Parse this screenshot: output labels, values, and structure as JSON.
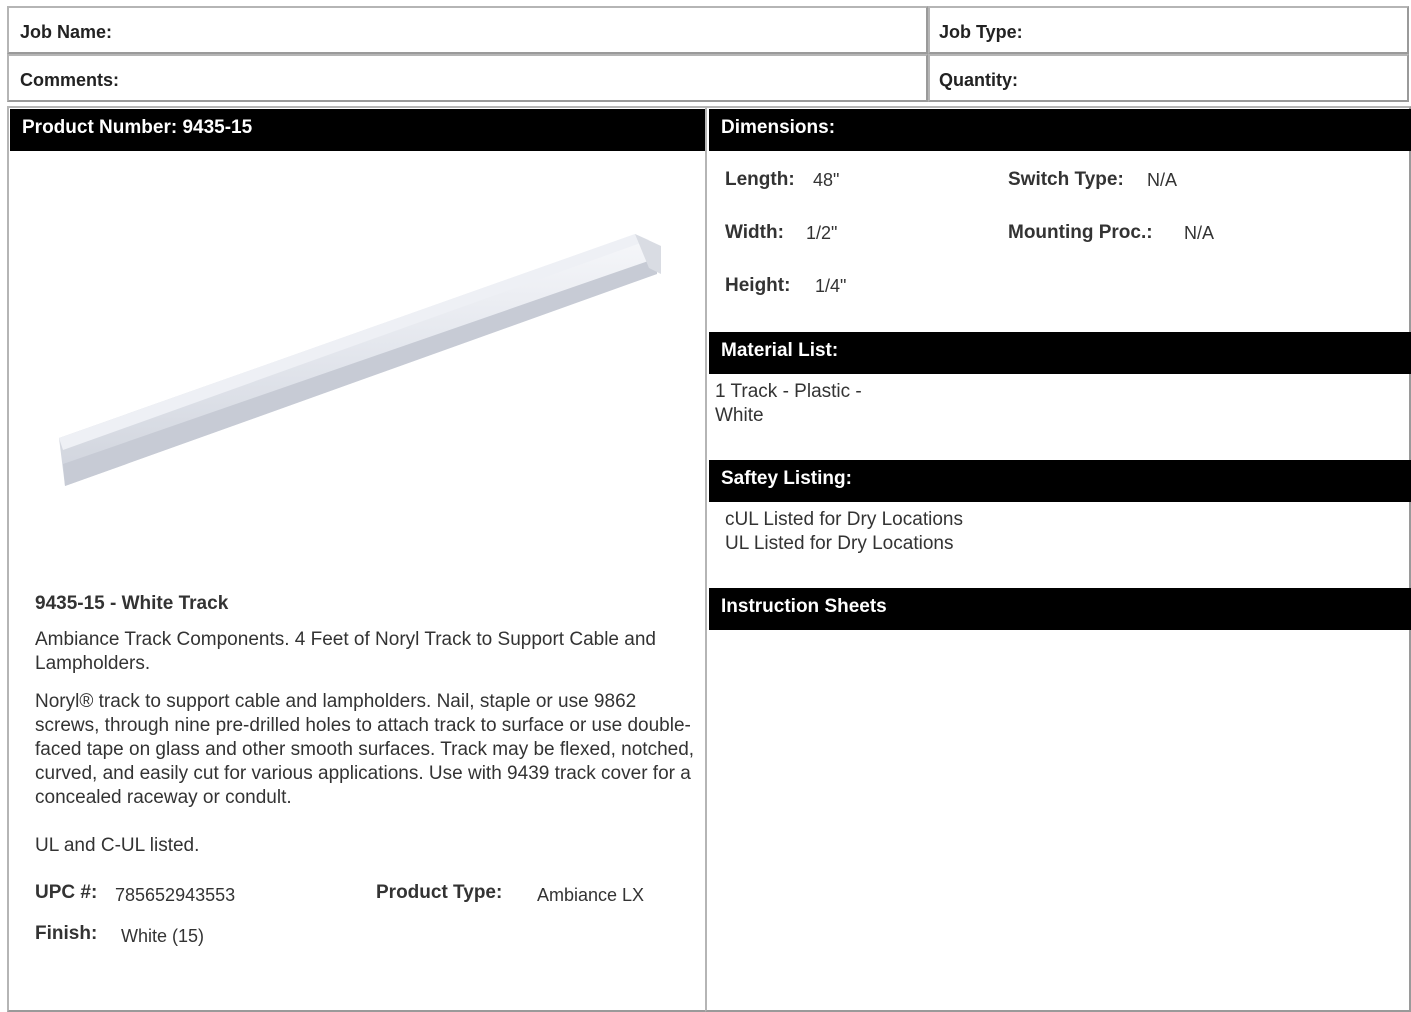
{
  "header": {
    "job_name_label": "Job Name:",
    "job_type_label": "Job Type:",
    "comments_label": "Comments:",
    "quantity_label": "Quantity:"
  },
  "left": {
    "product_number_label": "Product Number: 9435-15",
    "product_title": "9435-15 - White Track",
    "short_description": "Ambiance Track Components. 4 Feet of Noryl Track to Support Cable and Lampholders.",
    "long_description": "Noryl® track to support cable and lampholders. Nail, staple or use 9862 screws, through nine pre-drilled holes to attach track to surface or use double-faced tape on glass and other smooth surfaces. Track may be flexed, notched, curved, and easily cut for various applications. Use with 9439 track cover for a concealed raceway or condult.",
    "listing_note": "UL and C-UL listed.",
    "upc_label": "UPC #:",
    "upc_value": "785652943553",
    "product_type_label": "Product Type:",
    "product_type_value": "Ambiance LX",
    "finish_label": "Finish:",
    "finish_value": "White (15)"
  },
  "dimensions": {
    "title": "Dimensions:",
    "length_label": "Length:",
    "length_value": "48\"",
    "width_label": "Width:",
    "width_value": "1/2\"",
    "height_label": "Height:",
    "height_value": "1/4\"",
    "switch_type_label": "Switch Type:",
    "switch_type_value": "N/A",
    "mounting_label": "Mounting Proc.:",
    "mounting_value": "N/A"
  },
  "material": {
    "title": "Material List:",
    "line1": "1 Track - Plastic -",
    "line2": "White"
  },
  "safety": {
    "title": "Saftey Listing:",
    "line1": "cUL Listed for Dry Locations",
    "line2": "UL Listed for Dry Locations"
  },
  "instructions": {
    "title": "Instruction Sheets"
  }
}
